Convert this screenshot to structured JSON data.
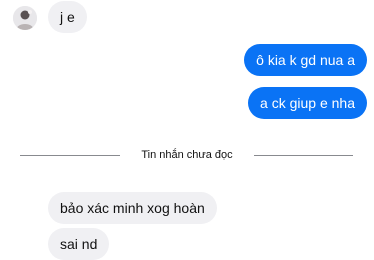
{
  "messages": [
    {
      "side": "received",
      "text": "j e"
    },
    {
      "side": "sent",
      "text": "ô kia k gd nua a"
    },
    {
      "side": "sent",
      "text": "a ck giup e nha"
    },
    {
      "side": "received",
      "text": "bảo xác minh xog hoàn"
    },
    {
      "side": "received",
      "text": "sai nd"
    }
  ],
  "unread_divider": {
    "label": "Tin nhắn chưa đọc"
  },
  "colors": {
    "sent_bubble": "#0a73f5",
    "received_bubble": "#f0f0f3",
    "divider_line": "#888a8f"
  }
}
